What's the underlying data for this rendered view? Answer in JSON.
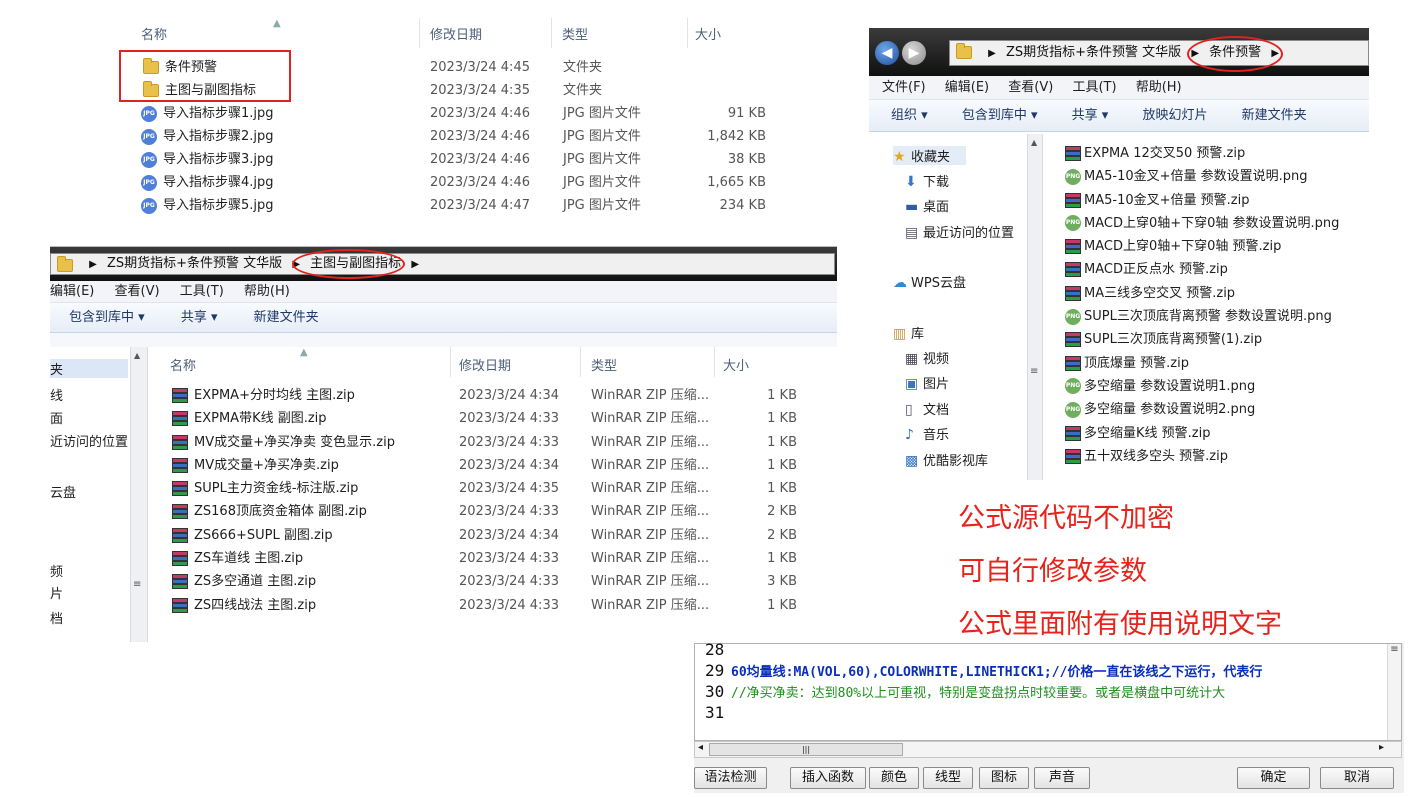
{
  "panel1": {
    "headers": {
      "name": "名称",
      "date": "修改日期",
      "type": "类型",
      "size": "大小"
    },
    "rows": [
      {
        "icon": "folder-icon",
        "name": "条件预警",
        "date": "2023/3/24 4:45",
        "type": "文件夹",
        "size": ""
      },
      {
        "icon": "folder-icon",
        "name": "主图与副图指标",
        "date": "2023/3/24 4:35",
        "type": "文件夹",
        "size": ""
      },
      {
        "icon": "jpg-icon",
        "name": "导入指标步骤1.jpg",
        "date": "2023/3/24 4:46",
        "type": "JPG 图片文件",
        "size": "91 KB"
      },
      {
        "icon": "jpg-icon",
        "name": "导入指标步骤2.jpg",
        "date": "2023/3/24 4:46",
        "type": "JPG 图片文件",
        "size": "1,842 KB"
      },
      {
        "icon": "jpg-icon",
        "name": "导入指标步骤3.jpg",
        "date": "2023/3/24 4:46",
        "type": "JPG 图片文件",
        "size": "38 KB"
      },
      {
        "icon": "jpg-icon",
        "name": "导入指标步骤4.jpg",
        "date": "2023/3/24 4:46",
        "type": "JPG 图片文件",
        "size": "1,665 KB"
      },
      {
        "icon": "jpg-icon",
        "name": "导入指标步骤5.jpg",
        "date": "2023/3/24 4:47",
        "type": "JPG 图片文件",
        "size": "234 KB"
      }
    ]
  },
  "panel2": {
    "path": [
      "ZS期货指标+条件预警 文华版",
      "主图与副图指标"
    ],
    "menu": [
      "编辑(E)",
      "查看(V)",
      "工具(T)",
      "帮助(H)"
    ],
    "toolbar": [
      "包含到库中 ▾",
      "共享 ▾",
      "新建文件夹"
    ],
    "sidebar": [
      "夹",
      "线",
      "面",
      "近访问的位置",
      "云盘",
      "频",
      "片",
      "档"
    ],
    "headers": {
      "name": "名称",
      "date": "修改日期",
      "type": "类型",
      "size": "大小"
    },
    "rows": [
      {
        "name": "EXPMA+分时均线 主图.zip",
        "date": "2023/3/24 4:34",
        "type": "WinRAR ZIP 压缩...",
        "size": "1 KB"
      },
      {
        "name": "EXPMA带K线 副图.zip",
        "date": "2023/3/24 4:33",
        "type": "WinRAR ZIP 压缩...",
        "size": "1 KB"
      },
      {
        "name": "MV成交量+净买净卖 变色显示.zip",
        "date": "2023/3/24 4:33",
        "type": "WinRAR ZIP 压缩...",
        "size": "1 KB"
      },
      {
        "name": "MV成交量+净买净卖.zip",
        "date": "2023/3/24 4:34",
        "type": "WinRAR ZIP 压缩...",
        "size": "1 KB"
      },
      {
        "name": "SUPL主力资金线-标注版.zip",
        "date": "2023/3/24 4:35",
        "type": "WinRAR ZIP 压缩...",
        "size": "1 KB"
      },
      {
        "name": "ZS168顶底资金箱体 副图.zip",
        "date": "2023/3/24 4:33",
        "type": "WinRAR ZIP 压缩...",
        "size": "2 KB"
      },
      {
        "name": "ZS666+SUPL 副图.zip",
        "date": "2023/3/24 4:34",
        "type": "WinRAR ZIP 压缩...",
        "size": "2 KB"
      },
      {
        "name": "ZS车道线 主图.zip",
        "date": "2023/3/24 4:33",
        "type": "WinRAR ZIP 压缩...",
        "size": "1 KB"
      },
      {
        "name": "ZS多空通道 主图.zip",
        "date": "2023/3/24 4:33",
        "type": "WinRAR ZIP 压缩...",
        "size": "3 KB"
      },
      {
        "name": "ZS四线战法 主图.zip",
        "date": "2023/3/24 4:33",
        "type": "WinRAR ZIP 压缩...",
        "size": "1 KB"
      }
    ]
  },
  "panel3": {
    "path": [
      "ZS期货指标+条件预警 文华版",
      "条件预警"
    ],
    "menu": [
      "文件(F)",
      "编辑(E)",
      "查看(V)",
      "工具(T)",
      "帮助(H)"
    ],
    "toolbar": [
      "组织 ▾",
      "包含到库中 ▾",
      "共享 ▾",
      "放映幻灯片",
      "新建文件夹"
    ],
    "sidebar": [
      {
        "icon": "star-icon",
        "label": "收藏夹"
      },
      {
        "icon": "download-icon",
        "label": "下载"
      },
      {
        "icon": "desktop-icon",
        "label": "桌面"
      },
      {
        "icon": "recent-icon",
        "label": "最近访问的位置"
      },
      {
        "icon": "cloud-icon",
        "label": "WPS云盘"
      },
      {
        "icon": "library-icon",
        "label": "库"
      },
      {
        "icon": "video-icon",
        "label": "视频"
      },
      {
        "icon": "picture-icon",
        "label": "图片"
      },
      {
        "icon": "document-icon",
        "label": "文档"
      },
      {
        "icon": "music-icon",
        "label": "音乐"
      },
      {
        "icon": "video-library-icon",
        "label": "优酷影视库"
      }
    ],
    "files": [
      {
        "icon": "rar",
        "name": "EXPMA 12交叉50 预警.zip"
      },
      {
        "icon": "png",
        "name": "MA5-10金叉+倍量 参数设置说明.png"
      },
      {
        "icon": "rar",
        "name": "MA5-10金叉+倍量 预警.zip"
      },
      {
        "icon": "png",
        "name": "MACD上穿0轴+下穿0轴 参数设置说明.png"
      },
      {
        "icon": "rar",
        "name": "MACD上穿0轴+下穿0轴 预警.zip"
      },
      {
        "icon": "rar",
        "name": "MACD正反点水 预警.zip"
      },
      {
        "icon": "rar",
        "name": "MA三线多空交叉 预警.zip"
      },
      {
        "icon": "png",
        "name": "SUPL三次顶底背离预警 参数设置说明.png"
      },
      {
        "icon": "rar",
        "name": "SUPL三次顶底背离预警(1).zip"
      },
      {
        "icon": "rar",
        "name": "顶底爆量 预警.zip"
      },
      {
        "icon": "png",
        "name": "多空缩量 参数设置说明1.png"
      },
      {
        "icon": "png",
        "name": "多空缩量 参数设置说明2.png"
      },
      {
        "icon": "rar",
        "name": "多空缩量K线 预警.zip"
      },
      {
        "icon": "rar",
        "name": "五十双线多空头 预警.zip"
      }
    ]
  },
  "notes": [
    "公式源代码不加密",
    "可自行修改参数",
    "公式里面附有使用说明文字"
  ],
  "editor": {
    "lines": [
      {
        "num": "28",
        "text": ""
      },
      {
        "num": "29",
        "text": "60均量线:MA(VOL,60),COLORWHITE,LINETHICK1;//价格一直在该线之下运行，代表行"
      },
      {
        "num": "30",
        "text": "//净买净卖：达到80%以上可重视，特别是变盘拐点时较重要。或者是横盘中可统计大"
      },
      {
        "num": "31",
        "text": ""
      }
    ],
    "buttons": [
      "语法检测",
      "插入函数",
      "颜色",
      "线型",
      "图标",
      "声音",
      "确定",
      "取消"
    ]
  },
  "colors": {
    "highlight": "#e0231f",
    "code_blue": "#0a2fbf",
    "code_green": "#1f8f1f",
    "note_red": "#e8231b"
  }
}
